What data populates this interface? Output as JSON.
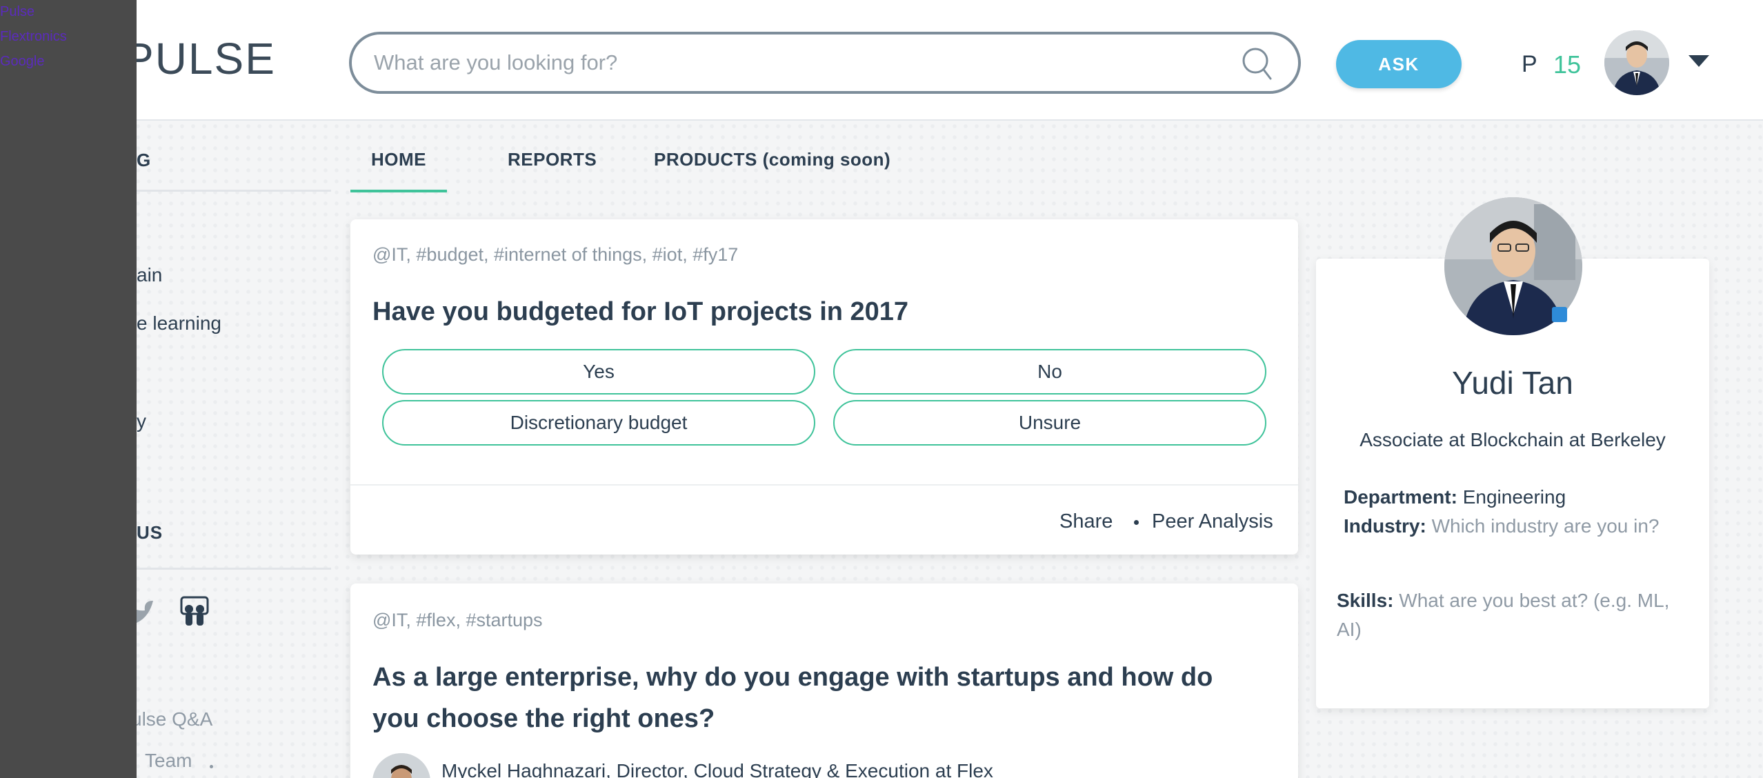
{
  "overlay": {
    "links": [
      "Pulse",
      "Flextronics",
      "Google"
    ]
  },
  "header": {
    "logo_text": "PULSE",
    "search_placeholder": "What are you looking for?",
    "ask_label": "ASK",
    "points_letter": "P",
    "points_value": "15"
  },
  "sidebar": {
    "heading_top": "G",
    "items": [
      "ain",
      "e learning",
      "y"
    ],
    "heading_bottom": "US",
    "footer": [
      "ulse Q&A",
      "Team"
    ]
  },
  "tabs": [
    "HOME",
    "REPORTS",
    "PRODUCTS (coming soon)"
  ],
  "feed": [
    {
      "tags": "@IT, #budget, #internet of things, #iot, #fy17",
      "question": "Have you budgeted for IoT projects in 2017",
      "options": [
        "Yes",
        "No",
        "Discretionary budget",
        "Unsure"
      ],
      "actions": [
        "Share",
        "Peer Analysis"
      ]
    },
    {
      "tags": "@IT, #flex, #startups",
      "question_line1": "As a large enterprise, why do you engage with startups and how do",
      "question_line2": "you choose the right ones?",
      "author": "Myckel Haghnazari, Director, Cloud Strategy & Execution at Flex"
    }
  ],
  "profile": {
    "name": "Yudi Tan",
    "subtitle": "Associate  at Blockchain at Berkeley",
    "department_label": "Department:",
    "department_value": "Engineering",
    "industry_label": "Industry:",
    "industry_placeholder": "Which industry are you in?",
    "skills_label": "Skills:",
    "skills_placeholder_line1": "What are you best at? (e.g. ML,",
    "skills_placeholder_line2": "AI)"
  },
  "colors": {
    "accent_green": "#3fc39a",
    "ask_blue": "#4fb9e4",
    "text_dark": "#2c3e50",
    "overlay": "#4a4a4a"
  }
}
